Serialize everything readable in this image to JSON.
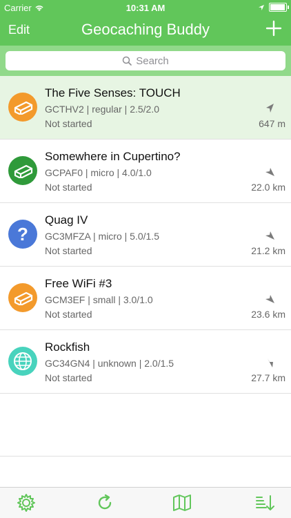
{
  "status": {
    "carrier": "Carrier",
    "time": "10:31 AM"
  },
  "nav": {
    "edit": "Edit",
    "title": "Geocaching Buddy"
  },
  "search": {
    "placeholder": "Search"
  },
  "items": [
    {
      "name": "The Five Senses: TOUCH",
      "meta": "GCTHV2 | regular | 2.5/2.0",
      "state": "Not started",
      "distance": "647 m",
      "icon": "traditional-cache-icon",
      "color": "#f39a2c",
      "selected": true
    },
    {
      "name": "Somewhere in Cupertino?",
      "meta": "GCPAF0 | micro | 4.0/1.0",
      "state": "Not started",
      "distance": "22.0 km",
      "icon": "traditional-cache-icon",
      "color": "#2f9a3a",
      "selected": false
    },
    {
      "name": "Quag IV",
      "meta": "GC3MFZA | micro | 5.0/1.5",
      "state": "Not started",
      "distance": "21.2 km",
      "icon": "mystery-cache-icon",
      "color": "#4a78d8",
      "selected": false
    },
    {
      "name": "Free WiFi #3",
      "meta": "GCM3EF | small | 3.0/1.0",
      "state": "Not started",
      "distance": "23.6 km",
      "icon": "multi-cache-icon",
      "color": "#f39a2c",
      "selected": false
    },
    {
      "name": "Rockfish",
      "meta": "GC34GN4 | unknown | 2.0/1.5",
      "state": "Not started",
      "distance": "27.7 km",
      "icon": "earth-cache-icon",
      "color": "#48d3bd",
      "selected": false
    }
  ],
  "toolbar": {
    "settings": "settings-icon",
    "refresh": "refresh-icon",
    "map": "map-icon",
    "sort": "sort-icon"
  },
  "colors": {
    "accent": "#61c65a",
    "accent_light": "#91d98a",
    "selected_row": "#e7f5e3"
  }
}
